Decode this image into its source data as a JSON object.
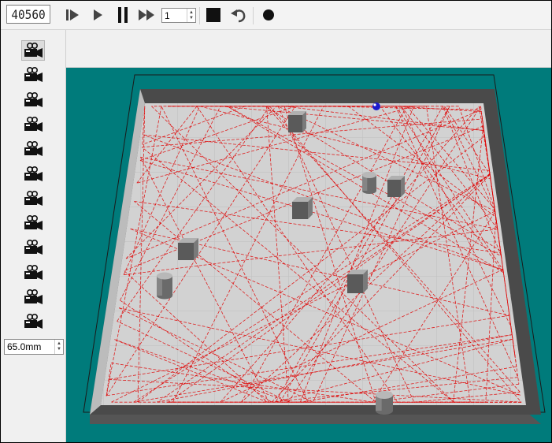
{
  "toolbar": {
    "counter": "40560",
    "speed_value": "1",
    "buttons": [
      {
        "name": "step-play-button",
        "icon": "step-play-icon"
      },
      {
        "name": "play-button",
        "icon": "play-icon"
      },
      {
        "name": "pause-button",
        "icon": "pause-icon"
      },
      {
        "name": "fast-forward-button",
        "icon": "fast-forward-icon"
      },
      {
        "name": "stop-button",
        "icon": "stop-icon"
      },
      {
        "name": "reset-button",
        "icon": "undo-arrow-icon"
      },
      {
        "name": "record-button",
        "icon": "record-icon"
      }
    ]
  },
  "sidebar": {
    "camera_count": 12,
    "selected_camera": 0,
    "camera_icon": "camera-icon",
    "distance_value": "65.0mm"
  },
  "scene": {
    "floor_color": "#d2d2d2",
    "wall_color": "#4a4a4a",
    "background_color": "#007b7b",
    "trail_color": "#e00000",
    "robot_color": "#1a1acc"
  }
}
